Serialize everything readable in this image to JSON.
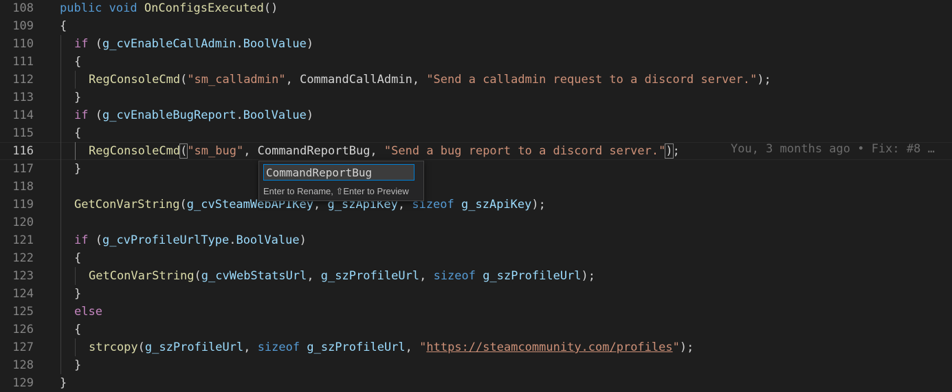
{
  "editor": {
    "lines": [
      {
        "num": "108",
        "tokens": [
          {
            "t": "public",
            "c": "kw"
          },
          {
            "t": " "
          },
          {
            "t": "void",
            "c": "kw"
          },
          {
            "t": " "
          },
          {
            "t": "OnConfigsExecuted",
            "c": "fn"
          },
          {
            "t": "()"
          }
        ]
      },
      {
        "num": "109",
        "tokens": [
          {
            "t": "{"
          }
        ]
      },
      {
        "num": "110",
        "indent": 1,
        "tokens": [
          {
            "t": "if",
            "c": "ctl"
          },
          {
            "t": " ("
          },
          {
            "t": "g_cvEnableCallAdmin",
            "c": "var"
          },
          {
            "t": "."
          },
          {
            "t": "BoolValue",
            "c": "var"
          },
          {
            "t": ")"
          }
        ]
      },
      {
        "num": "111",
        "indent": 1,
        "tokens": [
          {
            "t": "{"
          }
        ]
      },
      {
        "num": "112",
        "indent": 2,
        "tokens": [
          {
            "t": "RegConsoleCmd",
            "c": "fn"
          },
          {
            "t": "("
          },
          {
            "t": "\"sm_calladmin\"",
            "c": "str"
          },
          {
            "t": ", CommandCallAdmin, "
          },
          {
            "t": "\"Send a calladmin request to a discord server.\"",
            "c": "str"
          },
          {
            "t": ");"
          }
        ]
      },
      {
        "num": "113",
        "indent": 1,
        "tokens": [
          {
            "t": "}"
          }
        ]
      },
      {
        "num": "114",
        "indent": 1,
        "tokens": [
          {
            "t": "if",
            "c": "ctl"
          },
          {
            "t": " ("
          },
          {
            "t": "g_cvEnableBugReport",
            "c": "var"
          },
          {
            "t": "."
          },
          {
            "t": "BoolValue",
            "c": "var"
          },
          {
            "t": ")"
          }
        ]
      },
      {
        "num": "115",
        "indent": 1,
        "tokens": [
          {
            "t": "{"
          }
        ]
      },
      {
        "num": "116",
        "indent": 2,
        "current": true,
        "tokens": [
          {
            "t": "RegConsoleCmd",
            "c": "fn"
          },
          {
            "t": "(",
            "c": "br-match"
          },
          {
            "t": "\"sm_bug\"",
            "c": "str"
          },
          {
            "t": ", CommandReportBug, "
          },
          {
            "t": "\"Send a bug report to a discord server.\"",
            "c": "str"
          },
          {
            "t": ")",
            "c": "br-match"
          },
          {
            "t": ";"
          }
        ]
      },
      {
        "num": "117",
        "indent": 1,
        "tokens": [
          {
            "t": "}"
          }
        ]
      },
      {
        "num": "118",
        "indent": 1,
        "tokens": []
      },
      {
        "num": "119",
        "indent": 1,
        "tokens": [
          {
            "t": "GetConVarString",
            "c": "fn"
          },
          {
            "t": "("
          },
          {
            "t": "g_cvSteamWebAPIKey",
            "c": "var"
          },
          {
            "t": ", "
          },
          {
            "t": "g_szApiKey",
            "c": "var"
          },
          {
            "t": ", "
          },
          {
            "t": "sizeof",
            "c": "kw"
          },
          {
            "t": " "
          },
          {
            "t": "g_szApiKey",
            "c": "var"
          },
          {
            "t": ");"
          }
        ]
      },
      {
        "num": "120",
        "indent": 1,
        "tokens": []
      },
      {
        "num": "121",
        "indent": 1,
        "tokens": [
          {
            "t": "if",
            "c": "ctl"
          },
          {
            "t": " ("
          },
          {
            "t": "g_cvProfileUrlType",
            "c": "var"
          },
          {
            "t": "."
          },
          {
            "t": "BoolValue",
            "c": "var"
          },
          {
            "t": ")"
          }
        ]
      },
      {
        "num": "122",
        "indent": 1,
        "tokens": [
          {
            "t": "{"
          }
        ]
      },
      {
        "num": "123",
        "indent": 2,
        "tokens": [
          {
            "t": "GetConVarString",
            "c": "fn"
          },
          {
            "t": "("
          },
          {
            "t": "g_cvWebStatsUrl",
            "c": "var"
          },
          {
            "t": ", "
          },
          {
            "t": "g_szProfileUrl",
            "c": "var"
          },
          {
            "t": ", "
          },
          {
            "t": "sizeof",
            "c": "kw"
          },
          {
            "t": " "
          },
          {
            "t": "g_szProfileUrl",
            "c": "var"
          },
          {
            "t": ");"
          }
        ]
      },
      {
        "num": "124",
        "indent": 1,
        "tokens": [
          {
            "t": "}"
          }
        ]
      },
      {
        "num": "125",
        "indent": 1,
        "tokens": [
          {
            "t": "else",
            "c": "ctl"
          }
        ]
      },
      {
        "num": "126",
        "indent": 1,
        "tokens": [
          {
            "t": "{"
          }
        ]
      },
      {
        "num": "127",
        "indent": 2,
        "tokens": [
          {
            "t": "strcopy",
            "c": "fn"
          },
          {
            "t": "("
          },
          {
            "t": "g_szProfileUrl",
            "c": "var"
          },
          {
            "t": ", "
          },
          {
            "t": "sizeof",
            "c": "kw"
          },
          {
            "t": " "
          },
          {
            "t": "g_szProfileUrl",
            "c": "var"
          },
          {
            "t": ", "
          },
          {
            "t": "\"",
            "c": "str"
          },
          {
            "t": "https://steamcommunity.com/profiles",
            "c": "str link"
          },
          {
            "t": "\"",
            "c": "str"
          },
          {
            "t": ");"
          }
        ]
      },
      {
        "num": "128",
        "indent": 1,
        "tokens": [
          {
            "t": "}"
          }
        ]
      },
      {
        "num": "129",
        "tokens": [
          {
            "t": "}"
          }
        ]
      }
    ],
    "blame": "You, 3 months ago • Fix: #8 …"
  },
  "rename": {
    "value": "CommandReportBug",
    "hint": "Enter to Rename, ⇧Enter to Preview"
  }
}
